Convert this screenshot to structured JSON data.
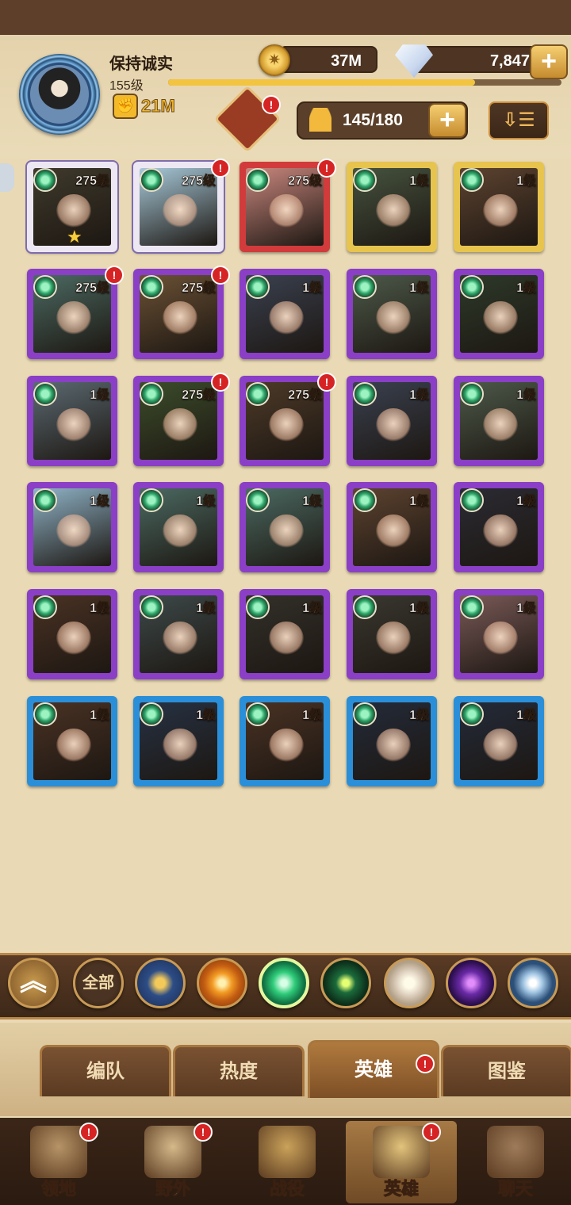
{
  "player": {
    "name": "保持诚实",
    "level": "155级",
    "xp_fraction": 0.78,
    "power": "21M"
  },
  "resources": {
    "gold": "37M",
    "diamonds": "7,847"
  },
  "roster": {
    "count": "145/180"
  },
  "colors": {
    "gold_frame": "#e6c44e",
    "purple_frame": "#8a3fc6",
    "blue_frame": "#2a8fd8",
    "red_frame": "#d23b3b",
    "badge": "#d62424"
  },
  "heroes": [
    {
      "level": "275级",
      "frame": "white",
      "badge": false,
      "star": true,
      "art": "#3f3a2c"
    },
    {
      "level": "275级",
      "frame": "white",
      "badge": true,
      "star": false,
      "art": "#a7c9d9"
    },
    {
      "level": "275级",
      "frame": "red",
      "badge": true,
      "star": false,
      "art": "#c9877e"
    },
    {
      "level": "1级",
      "frame": "gold",
      "badge": false,
      "star": false,
      "art": "#46533f"
    },
    {
      "level": "1级",
      "frame": "gold",
      "badge": false,
      "star": false,
      "art": "#5d4330"
    },
    {
      "level": "275级",
      "frame": "purple",
      "badge": true,
      "star": false,
      "art": "#4b6a62"
    },
    {
      "level": "275级",
      "frame": "purple",
      "badge": true,
      "star": false,
      "art": "#6b5135"
    },
    {
      "level": "1级",
      "frame": "purple",
      "badge": false,
      "star": false,
      "art": "#3a4150"
    },
    {
      "level": "1级",
      "frame": "purple",
      "badge": false,
      "star": false,
      "art": "#4d5a4a"
    },
    {
      "level": "1级",
      "frame": "purple",
      "badge": false,
      "star": false,
      "art": "#2d3a2a"
    },
    {
      "level": "1级",
      "frame": "purple",
      "badge": false,
      "star": false,
      "art": "#5b6a72"
    },
    {
      "level": "275级",
      "frame": "purple",
      "badge": true,
      "star": false,
      "art": "#3c4d2b"
    },
    {
      "level": "275级",
      "frame": "purple",
      "badge": true,
      "star": false,
      "art": "#4d3a28"
    },
    {
      "level": "1级",
      "frame": "purple",
      "badge": false,
      "star": false,
      "art": "#3a4150"
    },
    {
      "level": "1级",
      "frame": "purple",
      "badge": false,
      "star": false,
      "art": "#4d5a4a"
    },
    {
      "level": "1级",
      "frame": "purple",
      "badge": false,
      "star": false,
      "art": "#8fb3c7"
    },
    {
      "level": "1级",
      "frame": "purple",
      "badge": false,
      "star": false,
      "art": "#4b6a62"
    },
    {
      "level": "1级",
      "frame": "purple",
      "badge": false,
      "star": false,
      "art": "#4b6a62"
    },
    {
      "level": "1级",
      "frame": "purple",
      "badge": false,
      "star": false,
      "art": "#5d4330"
    },
    {
      "level": "1级",
      "frame": "purple",
      "badge": false,
      "star": false,
      "art": "#2b2b33"
    },
    {
      "level": "1级",
      "frame": "purple",
      "badge": false,
      "star": false,
      "art": "#4a3224"
    },
    {
      "level": "1级",
      "frame": "purple",
      "badge": false,
      "star": false,
      "art": "#3d4a4a"
    },
    {
      "level": "1级",
      "frame": "purple",
      "badge": false,
      "star": false,
      "art": "#33302a"
    },
    {
      "level": "1级",
      "frame": "purple",
      "badge": false,
      "star": false,
      "art": "#3a3830"
    },
    {
      "level": "1级",
      "frame": "purple",
      "badge": false,
      "star": false,
      "art": "#7a5a58"
    },
    {
      "level": "1级",
      "frame": "blue",
      "badge": false,
      "star": false,
      "art": "#4a3224"
    },
    {
      "level": "1级",
      "frame": "blue",
      "badge": false,
      "star": false,
      "art": "#263244"
    },
    {
      "level": "1级",
      "frame": "blue",
      "badge": false,
      "star": false,
      "art": "#4a3224"
    },
    {
      "level": "1级",
      "frame": "blue",
      "badge": false,
      "star": false,
      "art": "#232b3a"
    },
    {
      "level": "1级",
      "frame": "blue",
      "badge": false,
      "star": false,
      "art": "#232b3a"
    }
  ],
  "factions": {
    "all_label": "全部",
    "items": [
      "up-chevron-icon",
      "all",
      "lightbearer-icon",
      "mauler-icon",
      "wilder-icon",
      "graveborn-icon",
      "celestial-icon",
      "hypogean-icon",
      "dimensional-icon"
    ]
  },
  "subtabs": [
    {
      "label": "编队",
      "badge": false,
      "active": false
    },
    {
      "label": "热度",
      "badge": false,
      "active": false
    },
    {
      "label": "英雄",
      "badge": true,
      "active": true
    },
    {
      "label": "图鉴",
      "badge": false,
      "active": false
    }
  ],
  "nav": [
    {
      "label": "领地",
      "badge": true,
      "active": false,
      "icon": "castle-icon"
    },
    {
      "label": "野外",
      "badge": true,
      "active": false,
      "icon": "map-icon"
    },
    {
      "label": "战役",
      "badge": false,
      "active": false,
      "icon": "sword-icon"
    },
    {
      "label": "英雄",
      "badge": true,
      "active": true,
      "icon": "helmet-icon"
    },
    {
      "label": "聊天",
      "badge": false,
      "active": false,
      "icon": "chat-icon"
    }
  ]
}
